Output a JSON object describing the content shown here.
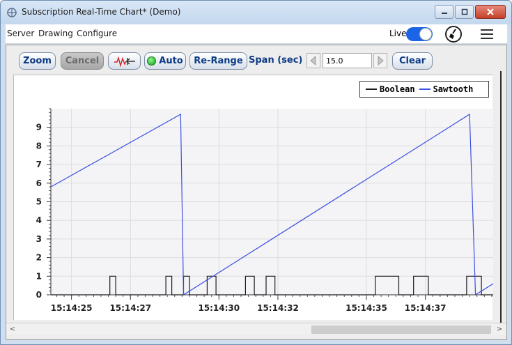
{
  "window": {
    "title": "Subscription Real-Time Chart* (Demo)"
  },
  "menubar": {
    "items": [
      "Server",
      "Drawing",
      "Configure"
    ],
    "live_label": "Live",
    "live_on": true,
    "broom_icon": "broom-icon",
    "menu_icon": "hamburger-menu-icon"
  },
  "toolbar": {
    "zoom": "Zoom",
    "cancel": "Cancel",
    "signal_icon": "signal-reset-icon",
    "auto": "Auto",
    "rerange": "Re-Range",
    "span_label": "Span (sec)",
    "span_value": "15.0",
    "clear": "Clear"
  },
  "colors": {
    "boolean": "#1a1a1a",
    "sawtooth": "#3b4fe0",
    "grid": "#dcdcdc",
    "accent": "#0c3a84"
  },
  "chart_data": {
    "type": "line",
    "title": "",
    "xlabel": "",
    "ylabel": "",
    "ylim": [
      0,
      10
    ],
    "yticks": [
      0,
      1,
      2,
      3,
      4,
      5,
      6,
      7,
      8,
      9
    ],
    "xlim": [
      "15:14:24.3",
      "15:14:39.3"
    ],
    "xticks": [
      "15:14:25",
      "15:14:27",
      "15:14:30",
      "15:14:32",
      "15:14:35",
      "15:14:37"
    ],
    "grid": true,
    "legend_position": "top-right",
    "series": [
      {
        "name": "Boolean",
        "x": [
          "15:14:24.3",
          "15:14:26.3",
          "15:14:26.3",
          "15:14:26.5",
          "15:14:26.5",
          "15:14:28.2",
          "15:14:28.2",
          "15:14:28.4",
          "15:14:28.4",
          "15:14:28.8",
          "15:14:28.8",
          "15:14:29.0",
          "15:14:29.0",
          "15:14:29.6",
          "15:14:29.6",
          "15:14:29.9",
          "15:14:29.9",
          "15:14:30.9",
          "15:14:30.9",
          "15:14:31.2",
          "15:14:31.2",
          "15:14:31.6",
          "15:14:31.6",
          "15:14:31.9",
          "15:14:31.9",
          "15:14:35.3",
          "15:14:35.3",
          "15:14:36.1",
          "15:14:36.1",
          "15:14:36.6",
          "15:14:36.6",
          "15:14:37.1",
          "15:14:37.1",
          "15:14:38.4",
          "15:14:38.4",
          "15:14:38.9",
          "15:14:38.9",
          "15:14:39.3"
        ],
        "y": [
          0,
          0,
          1,
          1,
          0,
          0,
          1,
          1,
          0,
          0,
          1,
          1,
          0,
          0,
          1,
          1,
          0,
          0,
          1,
          1,
          0,
          0,
          1,
          1,
          0,
          0,
          1,
          1,
          0,
          0,
          1,
          1,
          0,
          0,
          1,
          1,
          0,
          0
        ]
      },
      {
        "name": "Sawtooth",
        "x": [
          "15:14:24.3",
          "15:14:28.7",
          "15:14:28.8",
          "15:14:38.5",
          "15:14:38.7",
          "15:14:39.3"
        ],
        "y": [
          5.8,
          9.7,
          0,
          9.7,
          0,
          0.6
        ]
      }
    ]
  },
  "scrollbar": {
    "left_arrow": "<",
    "right_arrow": ">"
  }
}
